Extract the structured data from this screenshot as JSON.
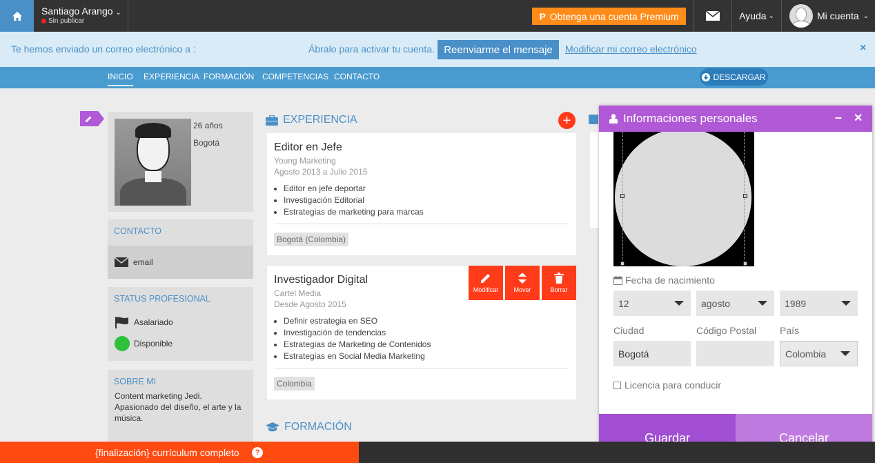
{
  "topbar": {
    "user_name": "Santiago Arango",
    "user_status": "Sin publicar",
    "premium_label": "Obtenga una cuenta Premium",
    "help_label": "Ayuda",
    "account_label": "Mi cuenta"
  },
  "notice": {
    "text_left": "Te hemos enviado un correo electrónico a :",
    "text_right": "Ábralo para activar tu cuenta.",
    "resend_label": "Reenviarme el mensaje",
    "modify_label": "Modificar mi correo electrónico",
    "close_symbol": "×"
  },
  "nav": {
    "items": [
      {
        "label": "INICIO",
        "active": true
      },
      {
        "label": "EXPERIENCIA",
        "active": false
      },
      {
        "label": "FORMACIÓN",
        "active": false
      },
      {
        "label": "COMPETENCIAS",
        "active": false
      },
      {
        "label": "CONTACTO",
        "active": false
      }
    ],
    "download_label": "DESCARGAR"
  },
  "profile": {
    "age": "26 años",
    "city": "Bogotá"
  },
  "contact": {
    "title": "CONTACTO",
    "email_label": "email"
  },
  "status": {
    "title": "STATUS PROFESIONAL",
    "employment": "Asalariado",
    "availability": "Disponible"
  },
  "about": {
    "title": "SOBRE MI",
    "text": "Content marketing Jedi. Apasionado del diseño, el arte y la música."
  },
  "experience": {
    "title": "EXPERIENCIA",
    "add_symbol": "+",
    "jobs": [
      {
        "title": "Editor en Jefe",
        "company": "Young Marketing",
        "dates": "Agosto 2013 a Julio 2015",
        "bullets": [
          "Editor en jefe deportar",
          "Investigación Editorial",
          "Estrategias de marketing para marcas"
        ],
        "location": "Bogotá (Colombia)"
      },
      {
        "title": "Investigador Digital",
        "company": "Cartel Media",
        "dates": "Desde Agosto 2015",
        "bullets": [
          "Definir estrategia en SEO",
          "Investigación de tendencias",
          "Estrategias de Marketing de Contenidos",
          "Estrategias en Social Media Marketing"
        ],
        "location": "Colombia"
      }
    ],
    "actions": {
      "edit_label": "Modificar",
      "move_label": "Mover",
      "delete_label": "Borrar"
    }
  },
  "education": {
    "title": "FORMACIÓN"
  },
  "modal": {
    "title": "Informaciones personales",
    "birth_label": "Fecha de nacimiento",
    "day": "12",
    "month": "agosto",
    "year": "1989",
    "city_label": "Ciudad",
    "city_value": "Bogotá",
    "postal_label": "Código Postal",
    "postal_value": "",
    "country_label": "País",
    "country_value": "Colombia",
    "license_label": "Licencia para conducir",
    "save_label": "Guardar",
    "cancel_label": "Cancelar"
  },
  "bottombar": {
    "progress_text": "{finalización} currículum completo",
    "progress_fraction": 0.41,
    "help_symbol": "?"
  },
  "colors": {
    "accent_blue": "#4a90c8",
    "premium_orange": "#ff8c1a",
    "action_red": "#ff3b1a",
    "modal_purple": "#b058d6"
  }
}
